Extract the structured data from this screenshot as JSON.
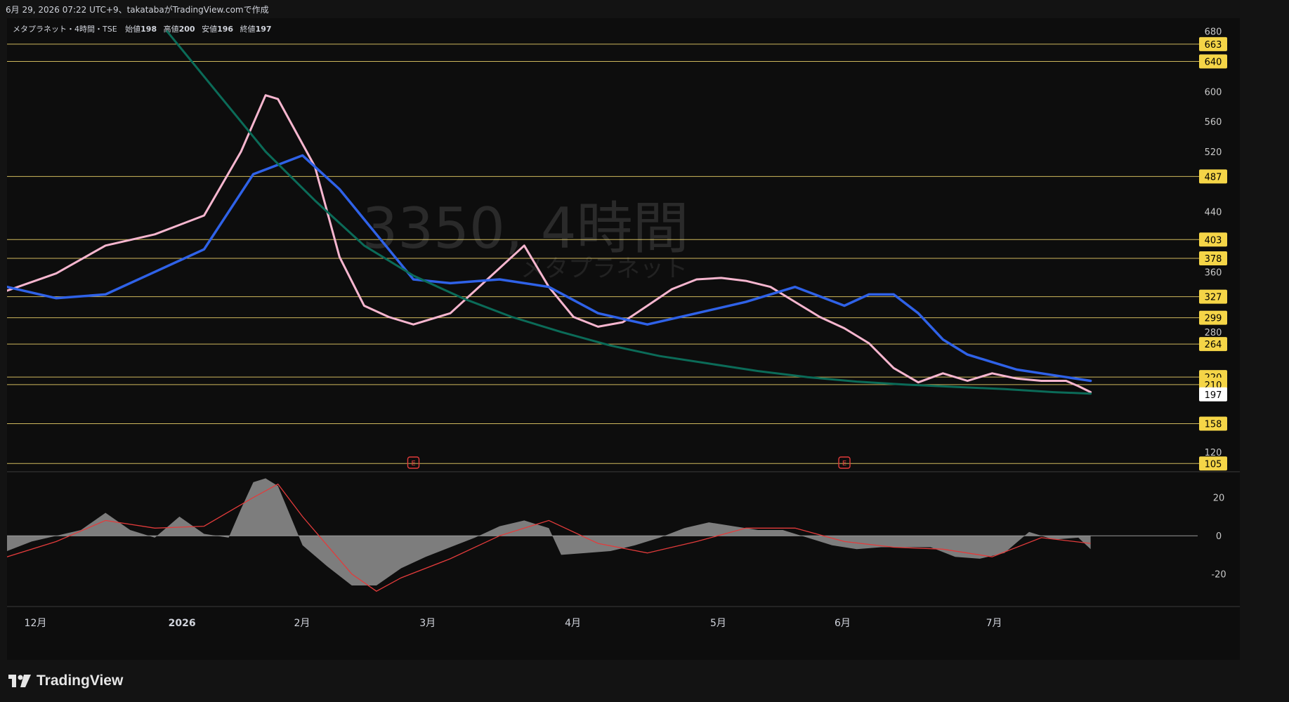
{
  "header": {
    "text": "6月 29, 2026 07:22 UTC+9、takatabaがTradingView.comで作成"
  },
  "symbol": {
    "line": "メタプラネット・4時間・TSE",
    "open_label": "始値",
    "open": "198",
    "high_label": "高値",
    "high": "200",
    "low_label": "安値",
    "low": "196",
    "close_label": "終値",
    "close": "197"
  },
  "watermark": {
    "main": "3350, 4時間",
    "sub": "メタプラネット"
  },
  "logo": {
    "text": "TradingView"
  },
  "colors": {
    "background": "#0d0d0d",
    "level_line": "#f0d66b",
    "level_badge": "#f5d547",
    "last_price_badge": "#ffffff",
    "up_candle": "#26c74a",
    "down_candle": "#ffffff",
    "ma_fast": "#f7b6cf",
    "ma_mid": "#2f62e8",
    "ma_slow": "#0b6b58",
    "bollinger": "#4a90d9",
    "ichimoku_line": "#f0f0f0",
    "macd_hist": "#8a8a8a",
    "macd_signal": "#e23b3b",
    "earnings": "#e23b3b"
  },
  "chart_data": [
    {
      "type": "line",
      "title": "メタプラネット・4時間・TSE",
      "x_ticks": [
        "12月",
        "2026",
        "2月",
        "3月",
        "4月",
        "5月",
        "6月",
        "7月"
      ],
      "y_ticks": [
        680,
        600,
        560,
        520,
        440,
        360,
        280,
        120
      ],
      "ylim": [
        95,
        690
      ],
      "grid": false,
      "last_price": {
        "value": 197,
        "label": "197"
      },
      "levels": [
        {
          "value": 663,
          "label": "663"
        },
        {
          "value": 640,
          "label": "640"
        },
        {
          "value": 487,
          "label": "487"
        },
        {
          "value": 403,
          "label": "403"
        },
        {
          "value": 378,
          "label": "378"
        },
        {
          "value": 327,
          "label": "327"
        },
        {
          "value": 299,
          "label": "299"
        },
        {
          "value": 264,
          "label": "264"
        },
        {
          "value": 220,
          "label": "220"
        },
        {
          "value": 210,
          "label": "210"
        },
        {
          "value": 158,
          "label": "158"
        },
        {
          "value": 105,
          "label": "105"
        }
      ],
      "earnings_markers": [
        {
          "x": 0.33,
          "label": "E"
        },
        {
          "x": 0.68,
          "label": "E"
        }
      ],
      "series": [
        {
          "style": "ma_fast",
          "x": [
            0,
            0.04,
            0.08,
            0.12,
            0.16,
            0.19,
            0.21,
            0.22,
            0.25,
            0.27,
            0.29,
            0.31,
            0.33,
            0.36,
            0.39,
            0.42,
            0.44,
            0.46,
            0.48,
            0.5,
            0.52,
            0.54,
            0.56,
            0.58,
            0.6,
            0.62,
            0.64,
            0.66,
            0.68,
            0.7,
            0.72,
            0.74,
            0.76,
            0.78,
            0.8,
            0.82,
            0.84,
            0.86,
            0.87,
            0.88
          ],
          "y": [
            335,
            358,
            395,
            410,
            435,
            520,
            595,
            590,
            500,
            380,
            315,
            300,
            290,
            305,
            350,
            395,
            340,
            300,
            287,
            293,
            315,
            337,
            350,
            352,
            348,
            340,
            320,
            300,
            285,
            265,
            232,
            213,
            225,
            215,
            225,
            218,
            215,
            215,
            208,
            200
          ]
        },
        {
          "style": "ma_mid",
          "x": [
            0,
            0.04,
            0.08,
            0.12,
            0.16,
            0.2,
            0.24,
            0.27,
            0.3,
            0.33,
            0.36,
            0.4,
            0.44,
            0.48,
            0.52,
            0.56,
            0.6,
            0.64,
            0.68,
            0.7,
            0.72,
            0.74,
            0.76,
            0.78,
            0.8,
            0.82,
            0.84,
            0.86,
            0.88
          ],
          "y": [
            340,
            325,
            330,
            360,
            390,
            490,
            515,
            470,
            410,
            350,
            345,
            350,
            340,
            305,
            290,
            305,
            320,
            340,
            315,
            330,
            330,
            305,
            270,
            250,
            240,
            230,
            225,
            220,
            215
          ]
        },
        {
          "style": "ma_slow",
          "x": [
            0.13,
            0.17,
            0.21,
            0.25,
            0.29,
            0.33,
            0.37,
            0.41,
            0.45,
            0.49,
            0.53,
            0.57,
            0.61,
            0.65,
            0.69,
            0.73,
            0.77,
            0.81,
            0.85,
            0.88
          ],
          "y": [
            680,
            600,
            520,
            455,
            395,
            355,
            325,
            300,
            280,
            262,
            248,
            238,
            228,
            220,
            214,
            210,
            207,
            204,
            200,
            198
          ]
        }
      ]
    },
    {
      "type": "area",
      "title": "",
      "y_ticks": [
        20,
        0,
        -20
      ],
      "ylim": [
        -37,
        32
      ],
      "grid": false,
      "series": [
        {
          "x": [
            0,
            0.02,
            0.04,
            0.06,
            0.08,
            0.1,
            0.12,
            0.14,
            0.16,
            0.18,
            0.19,
            0.2,
            0.21,
            0.22,
            0.24,
            0.26,
            0.28,
            0.3,
            0.32,
            0.34,
            0.36,
            0.38,
            0.4,
            0.42,
            0.44,
            0.45,
            0.47,
            0.49,
            0.51,
            0.53,
            0.55,
            0.57,
            0.59,
            0.61,
            0.63,
            0.65,
            0.67,
            0.69,
            0.71,
            0.73,
            0.75,
            0.77,
            0.79,
            0.81,
            0.83,
            0.85,
            0.87,
            0.88
          ],
          "values": [
            -8,
            -3,
            0,
            3,
            12,
            3,
            -1,
            10,
            1,
            -1,
            14,
            28,
            30,
            26,
            -5,
            -16,
            -26,
            -26,
            -17,
            -11,
            -6,
            -1,
            5,
            8,
            4,
            -10,
            -9,
            -8,
            -5,
            -1,
            4,
            7,
            5,
            3,
            3,
            -1,
            -5,
            -7,
            -6,
            -6,
            -6,
            -11,
            -12,
            -9,
            2,
            -2,
            -1,
            -7
          ]
        },
        {
          "x": [
            0,
            0.04,
            0.08,
            0.12,
            0.16,
            0.2,
            0.22,
            0.24,
            0.28,
            0.3,
            0.32,
            0.36,
            0.4,
            0.44,
            0.48,
            0.52,
            0.56,
            0.6,
            0.64,
            0.68,
            0.72,
            0.76,
            0.8,
            0.84,
            0.88
          ],
          "values": [
            -11,
            -3,
            8,
            4,
            5,
            20,
            27,
            10,
            -20,
            -29,
            -22,
            -12,
            0,
            8,
            -4,
            -9,
            -3,
            4,
            4,
            -3,
            -6,
            -7,
            -11,
            -1,
            -4
          ]
        }
      ]
    }
  ]
}
